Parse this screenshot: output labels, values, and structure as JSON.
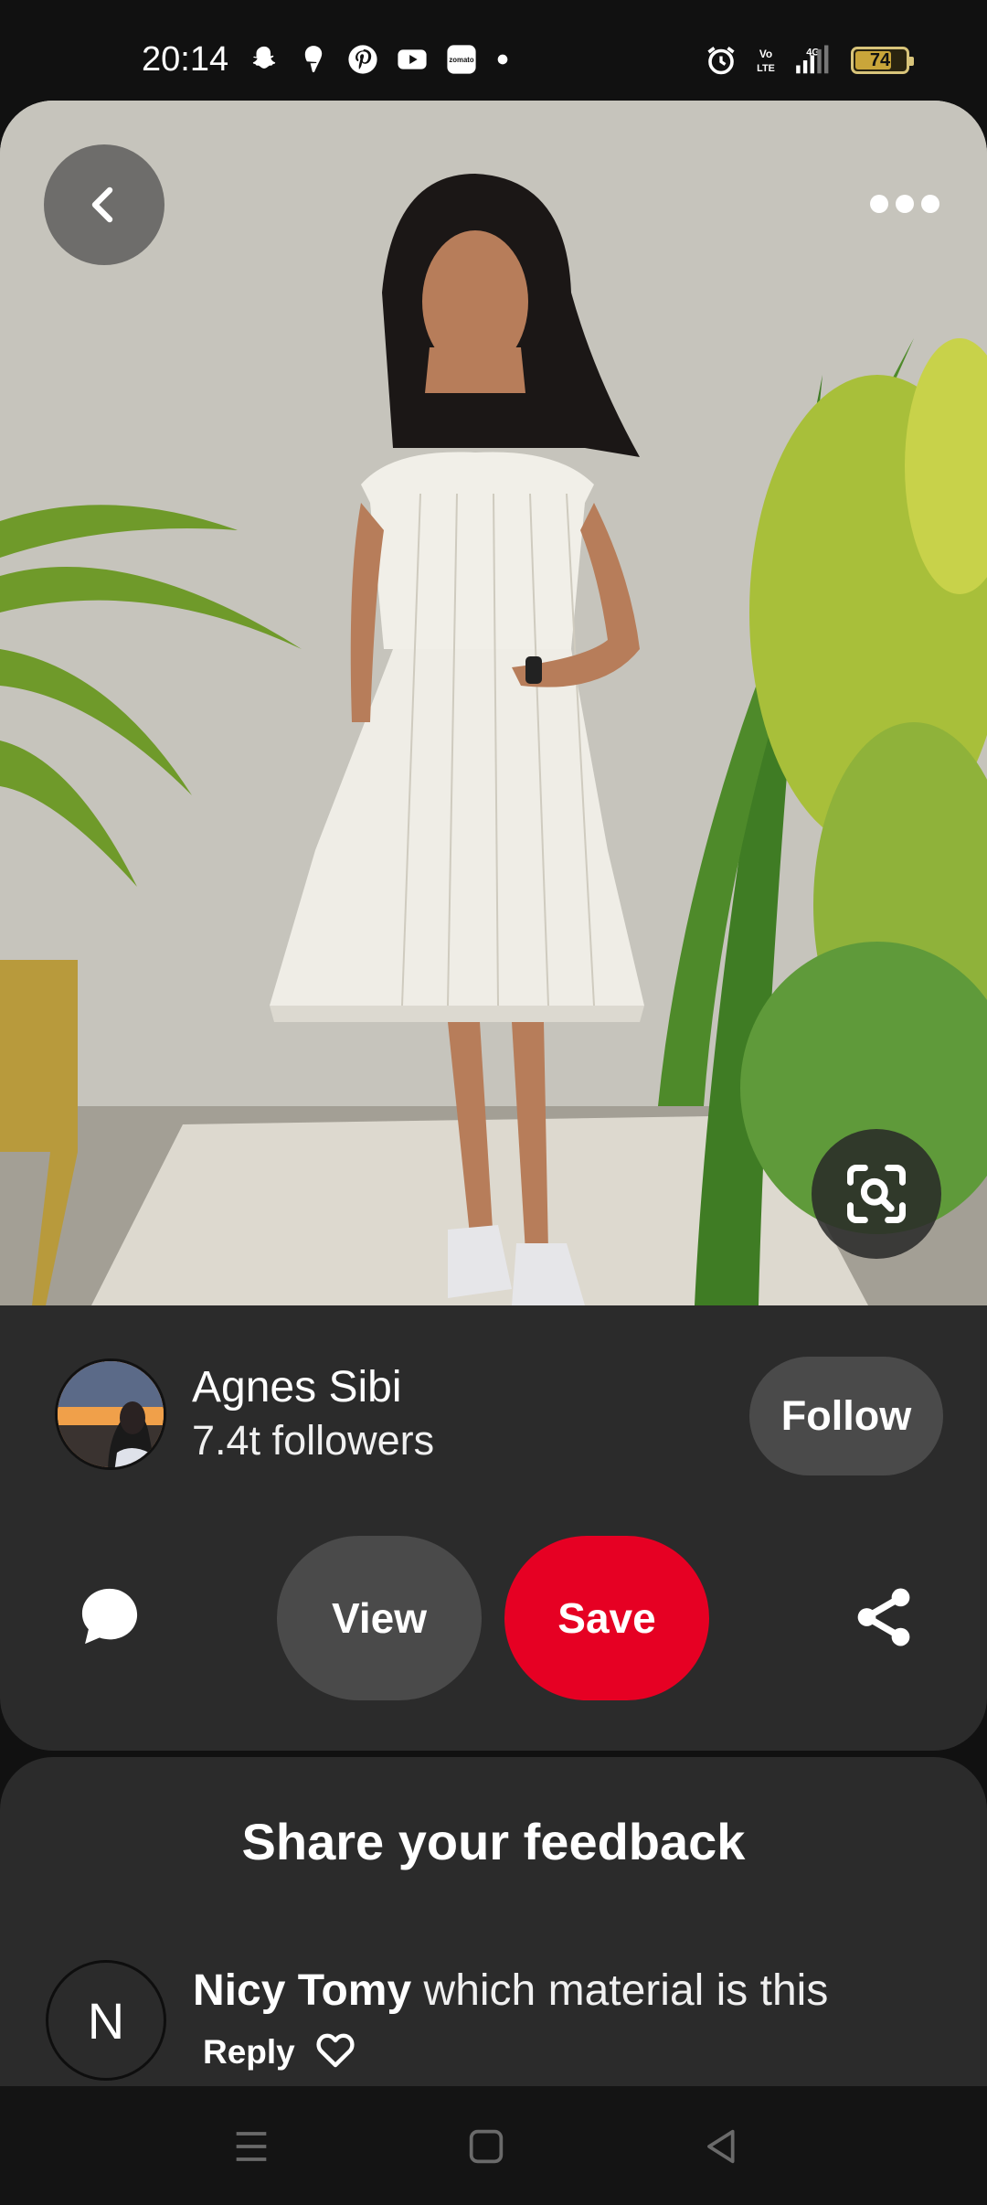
{
  "status_bar": {
    "time": "20:14",
    "notification_icons": [
      "snapchat-icon",
      "swiggy-icon",
      "pinterest-icon",
      "youtube-icon",
      "zomato-icon",
      "dot-icon"
    ],
    "zomato_label": "zomato",
    "right_icons": [
      "alarm-icon",
      "volte-icon",
      "4g-signal-icon"
    ],
    "volte_label": "Vo\nLTE",
    "network_label": "4G",
    "battery_level": "74",
    "battery_percent": 74
  },
  "pin": {
    "colors": {
      "wall": "#c9c7c0",
      "dress": "#f2f1ec",
      "plants": "#7fa832"
    }
  },
  "author": {
    "name": "Agnes Sibi",
    "followers": "7.4t followers",
    "follow_label": "Follow"
  },
  "actions": {
    "view_label": "View",
    "save_label": "Save",
    "save_color": "#e60023"
  },
  "feedback": {
    "title": "Share your feedback",
    "comments": [
      {
        "avatar_initial": "N",
        "author": "Nicy Tomy",
        "text": "which material is this",
        "reply_label": "Reply"
      }
    ]
  },
  "nav_bar": {
    "icons": [
      "menu-icon",
      "home-square-icon",
      "back-triangle-icon"
    ]
  }
}
